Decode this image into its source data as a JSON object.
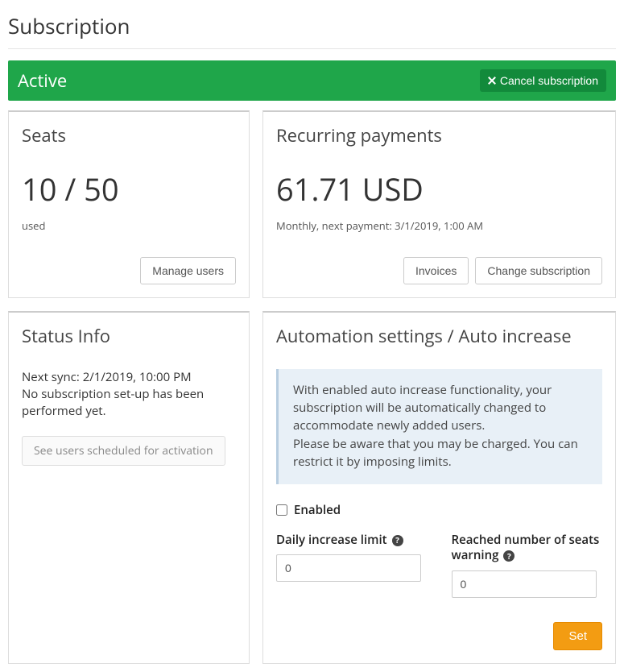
{
  "page_title": "Subscription",
  "status_bar": {
    "label": "Active",
    "cancel_label": "Cancel subscription"
  },
  "seats": {
    "title": "Seats",
    "value": "10 / 50",
    "caption": "used",
    "manage_label": "Manage users"
  },
  "payments": {
    "title": "Recurring payments",
    "value": "61.71 USD",
    "caption": "Monthly, next payment: 3/1/2019, 1:00 AM",
    "invoices_label": "Invoices",
    "change_label": "Change subscription"
  },
  "status_info": {
    "title": "Status Info",
    "line1": "Next sync: 2/1/2019, 10:00 PM",
    "line2": "No subscription set-up has been performed yet.",
    "scheduled_label": "See users scheduled for activation"
  },
  "automation": {
    "title": "Automation settings / Auto increase",
    "info_p1": "With enabled auto increase functionality, your subscription will be automatically changed to accommodate newly added users.",
    "info_p2": "Please be aware that you may be charged. You can restrict it by imposing limits.",
    "enabled_label": "Enabled",
    "daily_limit_label": "Daily increase limit",
    "daily_limit_value": "0",
    "warning_label": "Reached number of seats warning",
    "warning_value": "0",
    "set_label": "Set"
  }
}
